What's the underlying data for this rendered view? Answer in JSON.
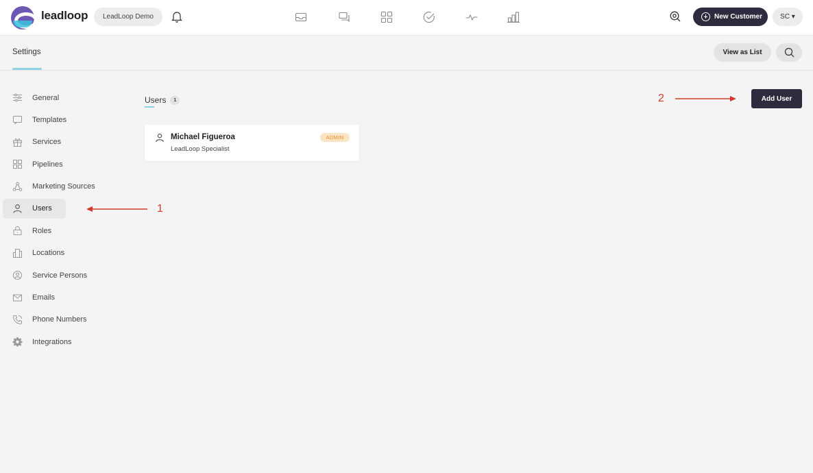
{
  "header": {
    "brand": "leadloop",
    "account": "LeadLoop Demo",
    "new_customer": "New Customer",
    "user_initials": "SC ▾"
  },
  "nav_icons": [
    "inbox-icon",
    "chat-icon",
    "pipelines-grid-icon",
    "tasks-check-icon",
    "activity-pulse-icon",
    "reports-chart-icon"
  ],
  "subheader": {
    "title": "Settings",
    "view_as_list": "View as List"
  },
  "sidebar": {
    "items": [
      {
        "label": "General",
        "icon": "sliders-icon"
      },
      {
        "label": "Templates",
        "icon": "message-icon"
      },
      {
        "label": "Services",
        "icon": "gift-icon"
      },
      {
        "label": "Pipelines",
        "icon": "grid-icon"
      },
      {
        "label": "Marketing Sources",
        "icon": "network-icon"
      },
      {
        "label": "Users",
        "icon": "user-icon",
        "active": true
      },
      {
        "label": "Roles",
        "icon": "lock-icon"
      },
      {
        "label": "Locations",
        "icon": "building-icon"
      },
      {
        "label": "Service Persons",
        "icon": "person-circle-icon"
      },
      {
        "label": "Emails",
        "icon": "mail-icon"
      },
      {
        "label": "Phone Numbers",
        "icon": "phone-icon"
      },
      {
        "label": "Integrations",
        "icon": "cog-icon"
      }
    ]
  },
  "main": {
    "title": "Users",
    "count": "1",
    "add_user": "Add User",
    "users": [
      {
        "name": "Michael Figueroa",
        "role": "LeadLoop Specialist",
        "badge": "ADMIN"
      }
    ]
  },
  "annotations": {
    "label_1": "1",
    "label_2": "2",
    "color": "#d23b2a"
  },
  "colors": {
    "dark_button": "#2c2c3e",
    "accent": "#8dd3e4",
    "admin_badge_bg": "#fbe3c4",
    "admin_badge_text": "#e0922f"
  }
}
